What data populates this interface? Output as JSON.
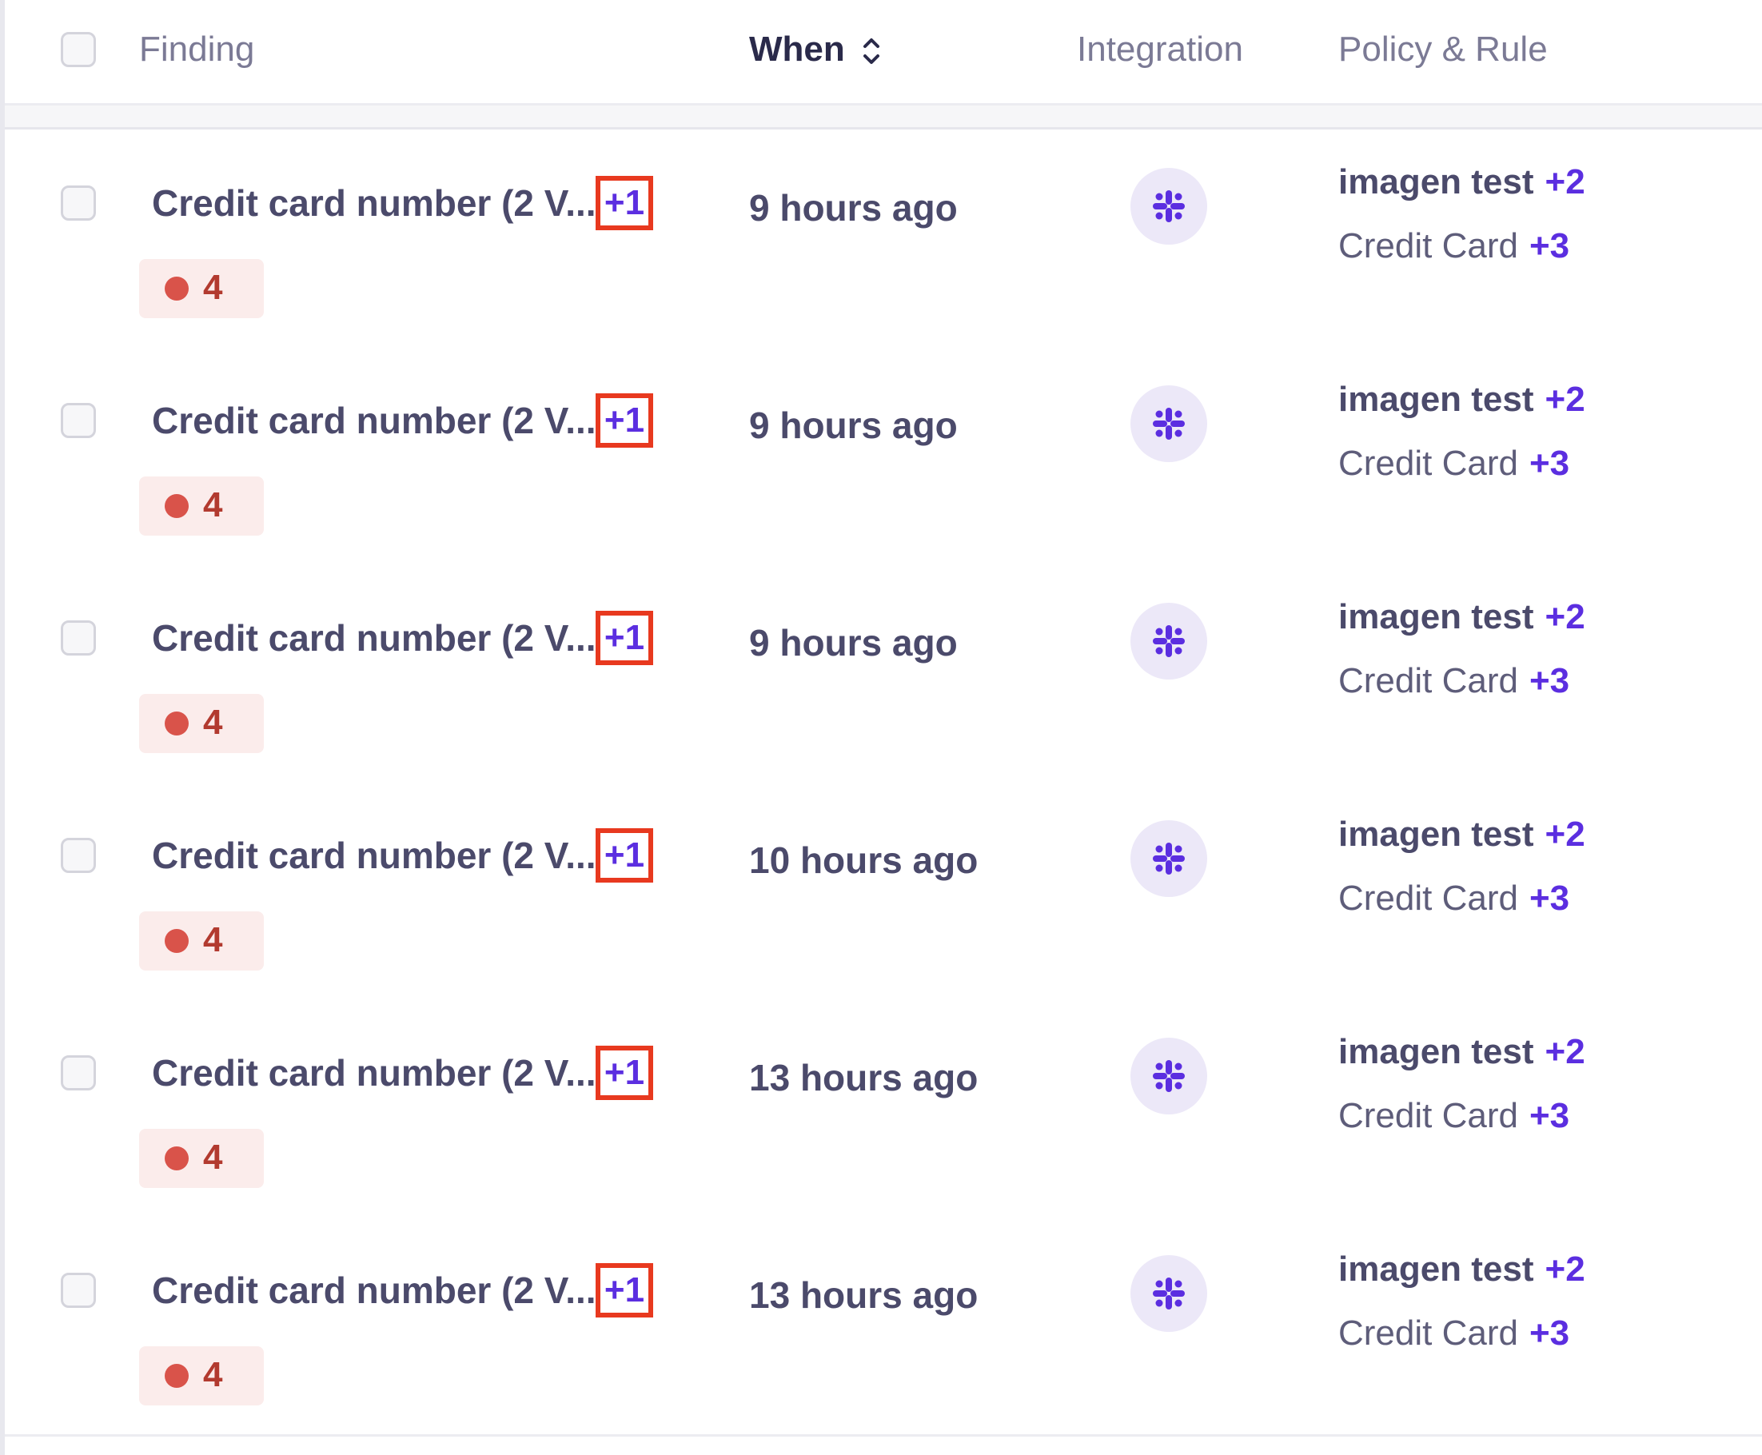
{
  "header": {
    "finding_label": "Finding",
    "when_label": "When",
    "integration_label": "Integration",
    "policy_label": "Policy & Rule"
  },
  "rows": [
    {
      "finding": "Credit card number (2 V...",
      "finding_more": "+1",
      "severity_count": "4",
      "when": "9 hours ago",
      "integration_icon": "slack-icon",
      "policy": "imagen test",
      "policy_more": "+2",
      "rule": "Credit Card",
      "rule_more": "+3"
    },
    {
      "finding": "Credit card number (2 V...",
      "finding_more": "+1",
      "severity_count": "4",
      "when": "9 hours ago",
      "integration_icon": "slack-icon",
      "policy": "imagen test",
      "policy_more": "+2",
      "rule": "Credit Card",
      "rule_more": "+3"
    },
    {
      "finding": "Credit card number (2 V...",
      "finding_more": "+1",
      "severity_count": "4",
      "when": "9 hours ago",
      "integration_icon": "slack-icon",
      "policy": "imagen test",
      "policy_more": "+2",
      "rule": "Credit Card",
      "rule_more": "+3"
    },
    {
      "finding": "Credit card number (2 V...",
      "finding_more": "+1",
      "severity_count": "4",
      "when": "10 hours ago",
      "integration_icon": "slack-icon",
      "policy": "imagen test",
      "policy_more": "+2",
      "rule": "Credit Card",
      "rule_more": "+3"
    },
    {
      "finding": "Credit card number (2 V...",
      "finding_more": "+1",
      "severity_count": "4",
      "when": "13 hours ago",
      "integration_icon": "slack-icon",
      "policy": "imagen test",
      "policy_more": "+2",
      "rule": "Credit Card",
      "rule_more": "+3"
    },
    {
      "finding": "Credit card number (2 V...",
      "finding_more": "+1",
      "severity_count": "4",
      "when": "13 hours ago",
      "integration_icon": "slack-icon",
      "policy": "imagen test",
      "policy_more": "+2",
      "rule": "Credit Card",
      "rule_more": "+3"
    }
  ],
  "colors": {
    "accent": "#5b2ee0",
    "highlight_box": "#e8391f",
    "severity_dot": "#d9534a",
    "severity_bg": "#fbeceb",
    "integration_bg": "#ece8f8"
  }
}
